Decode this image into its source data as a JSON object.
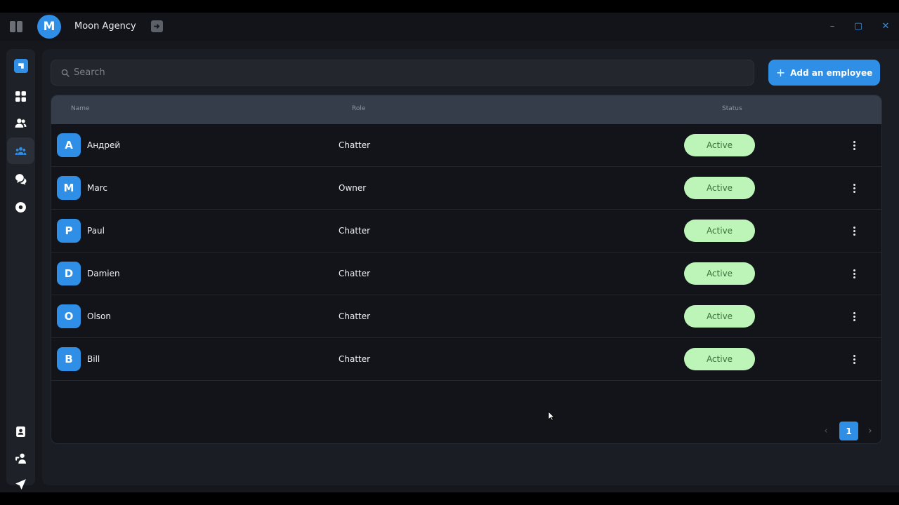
{
  "app": {
    "avatar_letter": "M",
    "title": "Moon Agency"
  },
  "window_controls": {
    "minimize": "–",
    "maximize": "▢",
    "close": "✕"
  },
  "sidebar": {
    "items": [
      {
        "icon": "dashboard-grid-icon"
      },
      {
        "icon": "users-icon"
      },
      {
        "icon": "team-icon",
        "active": true
      },
      {
        "icon": "chat-icon"
      },
      {
        "icon": "settings-circle-icon"
      }
    ],
    "bottom_items": [
      {
        "icon": "contact-book-icon"
      },
      {
        "icon": "user-key-icon"
      },
      {
        "icon": "send-icon"
      }
    ]
  },
  "search": {
    "placeholder": "Search"
  },
  "add_button": {
    "label": "Add an employee"
  },
  "table": {
    "columns": {
      "name": "Name",
      "role": "Role",
      "status": "Status"
    },
    "rows": [
      {
        "initial": "A",
        "name": "Андрей",
        "role": "Chatter",
        "status": "Active"
      },
      {
        "initial": "M",
        "name": "Marc",
        "role": "Owner",
        "status": "Active"
      },
      {
        "initial": "P",
        "name": "Paul",
        "role": "Chatter",
        "status": "Active"
      },
      {
        "initial": "D",
        "name": "Damien",
        "role": "Chatter",
        "status": "Active"
      },
      {
        "initial": "O",
        "name": "Olson",
        "role": "Chatter",
        "status": "Active"
      },
      {
        "initial": "B",
        "name": "Bill",
        "role": "Chatter",
        "status": "Active"
      }
    ]
  },
  "pagination": {
    "prev": "‹",
    "current_page": "1",
    "next": "›"
  },
  "colors": {
    "accent": "#2f8fe6",
    "status_active_bg": "#bdf5b8",
    "status_active_text": "#3b6f39"
  }
}
